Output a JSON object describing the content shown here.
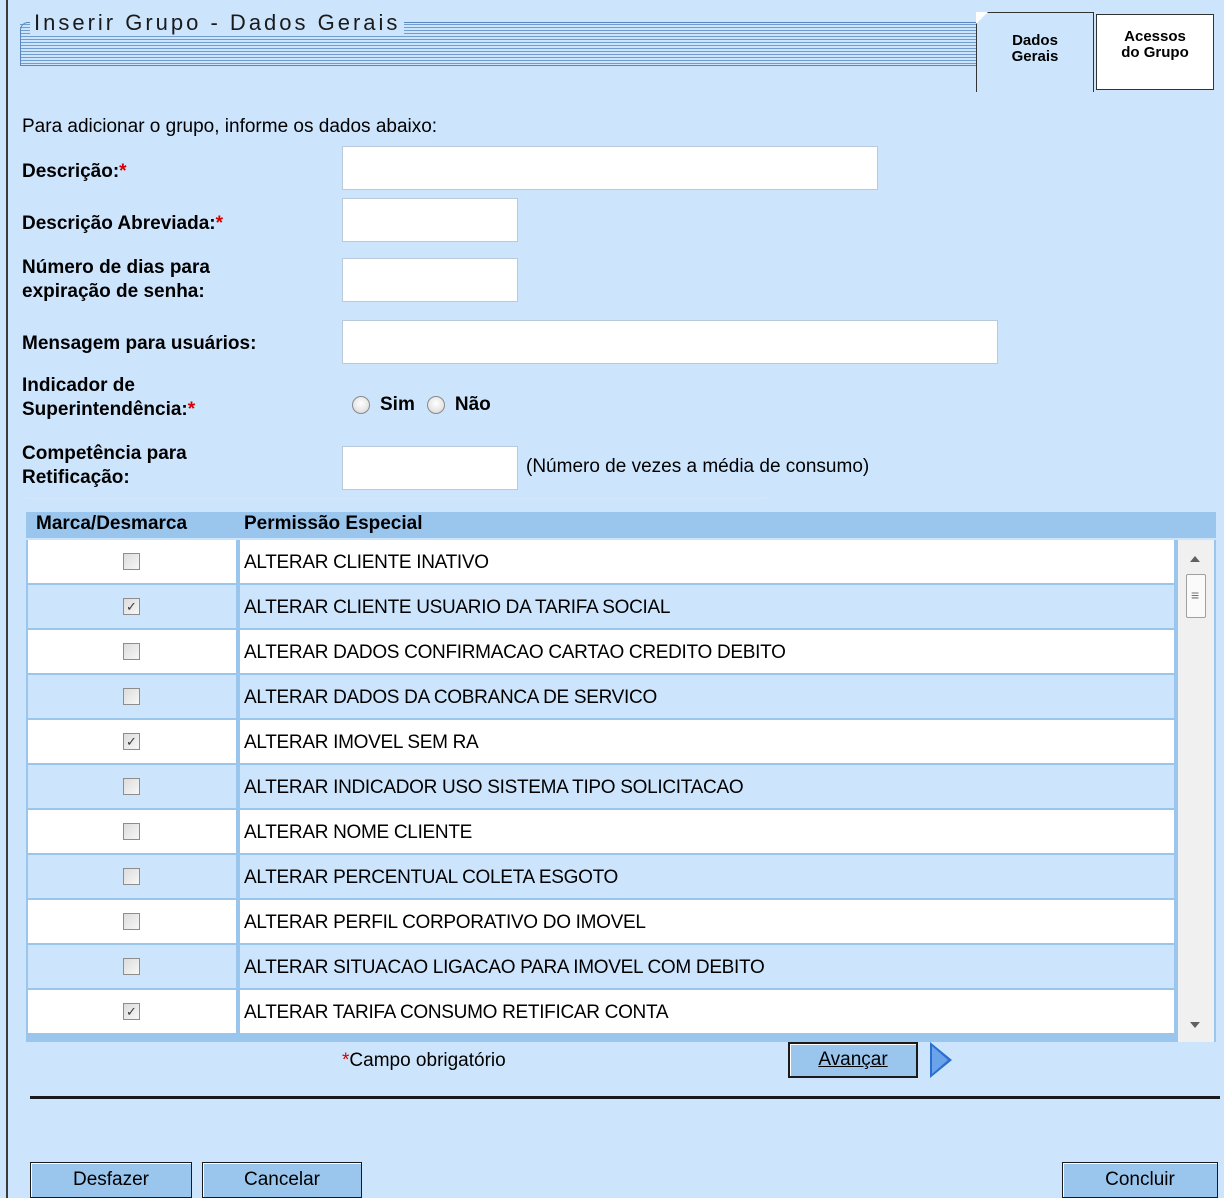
{
  "header": {
    "title": "Inserir Grupo - Dados Gerais"
  },
  "tabs": [
    {
      "line1": "Dados",
      "line2": "Gerais"
    },
    {
      "line1": "Acessos",
      "line2": "do Grupo"
    }
  ],
  "form": {
    "intro": "Para adicionar o grupo, informe os dados abaixo:",
    "descricao_label": "Descrição:",
    "descricao_abreviada_label": "Descrição Abreviada:",
    "dias_expiracao_label_1": "Número de dias para",
    "dias_expiracao_label_2": "expiração de senha:",
    "mensagem_label": "Mensagem para usuários:",
    "superintendencia_label_1": "Indicador de",
    "superintendencia_label_2": "Superintendência:",
    "required_mark": "*",
    "radio_sim": "Sim",
    "radio_nao": "Não",
    "competencia_label_1": "Competência para",
    "competencia_label_2": "Retificação:",
    "competencia_hint": "(Número de vezes a média de consumo)",
    "descricao_value": "",
    "descricao_abreviada_value": "",
    "dias_expiracao_value": "",
    "mensagem_value": "",
    "competencia_value": ""
  },
  "table": {
    "col_marca": "Marca/Desmarca",
    "col_permissao": "Permissão Especial",
    "rows": [
      {
        "label": "ALTERAR CLIENTE INATIVO",
        "checked": false
      },
      {
        "label": "ALTERAR CLIENTE USUARIO DA TARIFA SOCIAL",
        "checked": true
      },
      {
        "label": "ALTERAR DADOS CONFIRMACAO CARTAO CREDITO DEBITO",
        "checked": false
      },
      {
        "label": "ALTERAR DADOS DA COBRANCA DE SERVICO",
        "checked": false
      },
      {
        "label": "ALTERAR IMOVEL SEM RA",
        "checked": true
      },
      {
        "label": "ALTERAR INDICADOR USO SISTEMA TIPO SOLICITACAO",
        "checked": false
      },
      {
        "label": "ALTERAR NOME CLIENTE",
        "checked": false
      },
      {
        "label": "ALTERAR PERCENTUAL COLETA ESGOTO",
        "checked": false
      },
      {
        "label": "ALTERAR PERFIL CORPORATIVO DO IMOVEL",
        "checked": false
      },
      {
        "label": "ALTERAR SITUACAO LIGACAO PARA IMOVEL COM DEBITO",
        "checked": false
      },
      {
        "label": "ALTERAR TARIFA CONSUMO RETIFICAR CONTA",
        "checked": true
      }
    ]
  },
  "footer": {
    "required_note": "Campo obrigatório",
    "avancar": "Avançar",
    "desfazer": "Desfazer",
    "cancelar": "Cancelar",
    "concluir": "Concluir"
  }
}
